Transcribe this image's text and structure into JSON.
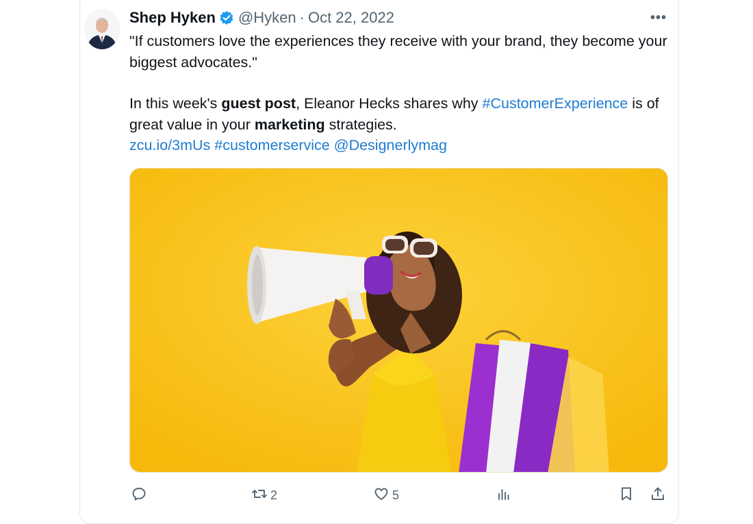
{
  "tweet": {
    "author_name": "Shep Hyken",
    "handle": "@Hyken",
    "separator": "·",
    "date": "Oct 22, 2022",
    "more_label": "•••",
    "quote_line": "\"If customers love the experiences they receive with your brand, they become your biggest advocates.\"",
    "body": {
      "part1": "In this week's ",
      "bold1": "guest post",
      "part2": ", Eleanor Hecks shares why ",
      "hashtag1": "#CustomerExperience",
      "part3": " is of great value in your ",
      "bold2": "marketing",
      "part4": " strategies."
    },
    "links": {
      "url": "zcu.io/3mUs",
      "hashtag2": "#customerservice",
      "mention": "@Designerlymag"
    }
  },
  "actions": {
    "reply_icon": "reply-icon",
    "retweet_icon": "retweet-icon",
    "retweet_count": "2",
    "like_icon": "heart-icon",
    "like_count": "5",
    "views_icon": "views-icon",
    "bookmark_icon": "bookmark-icon",
    "share_icon": "share-icon"
  },
  "colors": {
    "link": "#1d7bd0",
    "verified": "#1d9bf0",
    "muted": "#536471",
    "media_background": "#fbc415"
  }
}
